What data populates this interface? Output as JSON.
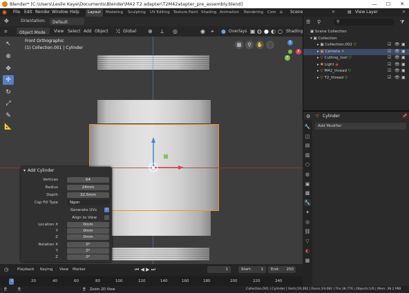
{
  "title_bar": {
    "title": "Blender* [C:\\Users\\Leslie Kaye\\Documents\\Blender\\M42 T2 adapter\\T2M42atapter_pre_assembly.blend]",
    "minimize": "—",
    "maximize": "☐",
    "close": "✕"
  },
  "menu": {
    "items": [
      "File",
      "Edit",
      "Render",
      "Window",
      "Help"
    ],
    "workspaces": [
      "Layout",
      "Modeling",
      "Sculpting",
      "UV Editing",
      "Texture Paint",
      "Shading",
      "Animation",
      "Rendering",
      "Com"
    ],
    "active_workspace": "Layout",
    "scene_label": "Scene",
    "view_layer_label": "View Layer"
  },
  "tool_settings": {
    "orientation_label": "Orientation:",
    "orientation_value": "Default"
  },
  "viewport_header": {
    "mode": "Object Mode",
    "menus": [
      "View",
      "Select",
      "Add",
      "Object"
    ],
    "transform_orientation": "Global",
    "overlays": "Overlays",
    "shading": "Shading"
  },
  "viewport": {
    "view_name": "Front Orthographic",
    "collection_info": "(1) Collection.001 | Cylinder"
  },
  "gizmo_axes": {
    "x": "X",
    "y": "Y",
    "z": "Z"
  },
  "redo_panel": {
    "title": "Add Cylinder",
    "vertices_label": "Vertices",
    "vertices": "64",
    "radius_label": "Radius",
    "radius": "24mm",
    "depth_label": "Depth",
    "depth": "32.5mm",
    "cap_fill_label": "Cap Fill Type",
    "cap_fill": "Ngon",
    "gen_uvs_label": "Generate UVs",
    "gen_uvs": true,
    "align_view_label": "Align to View",
    "align_view": false,
    "location_label": "Location X",
    "loc_x": "0mm",
    "y_label": "Y",
    "loc_y": "0mm",
    "z_label": "Z",
    "loc_z": "0mm",
    "rotation_label": "Rotation X",
    "rot_x": "0°",
    "rot_y": "0°",
    "rot_z": "0°"
  },
  "timeline": {
    "menus": [
      "Playback",
      "Keying",
      "View",
      "Marker"
    ],
    "current_frame": "1",
    "start_label": "Start:",
    "start": "1",
    "end_label": "End:",
    "end": "250",
    "ticks": [
      "0",
      "20",
      "40",
      "60",
      "80",
      "100",
      "120",
      "140",
      "160",
      "180",
      "200",
      "220",
      "240"
    ]
  },
  "outliner": {
    "search_placeholder": "",
    "items": [
      {
        "name": "Scene Collection",
        "depth": 0
      },
      {
        "name": "Collection",
        "depth": 1
      },
      {
        "name": "Collection.002",
        "depth": 2
      },
      {
        "name": "Camera",
        "depth": 2
      },
      {
        "name": "Cutting_tool",
        "depth": 2
      },
      {
        "name": "Light",
        "depth": 2
      },
      {
        "name": "M42_thread",
        "depth": 2
      },
      {
        "name": "T2_thread",
        "depth": 2
      }
    ]
  },
  "properties": {
    "object_name": "Cylinder",
    "add_modifier": "Add Modifier"
  },
  "status_bar": {
    "hint": "Zoom 2D View",
    "stats": "Collection.001 | Cylinder | Verts:19,392 | Faces:19,082 | Tris:38,776 | Objects:1/6 | Mem: 38.2 MiB"
  },
  "colors": {
    "accent": "#5680c2",
    "selected_outline": "#e8962a",
    "axis_x": "#e04050",
    "axis_y": "#80c040",
    "axis_z": "#4090e0"
  }
}
